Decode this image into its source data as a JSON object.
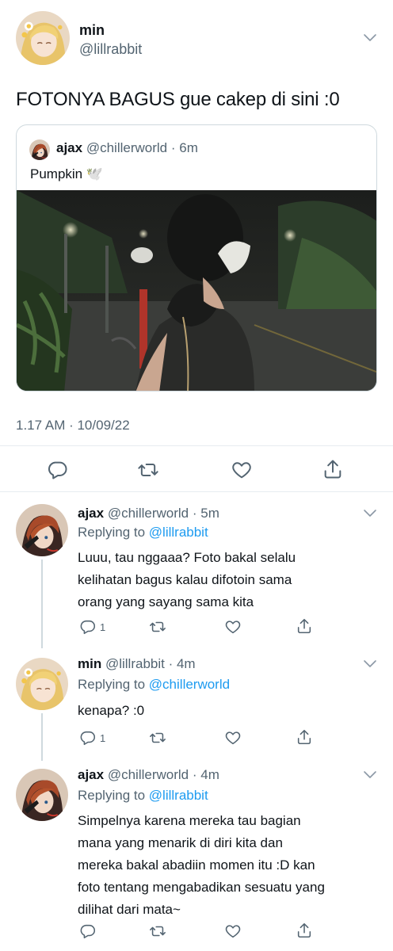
{
  "main_tweet": {
    "name": "min",
    "handle": "@lillrabbit",
    "text": "FOTONYA BAGUS gue cakep di sini :0",
    "timestamp": "1.17 AM · 10/09/22",
    "quote": {
      "name": "ajax",
      "handle": "@chillerworld",
      "time": "6m",
      "text": "Pumpkin 🕊️"
    },
    "actions": [
      "reply-icon",
      "retweet-icon",
      "like-icon",
      "share-icon"
    ]
  },
  "replies": [
    {
      "name": "ajax",
      "handle": "@chillerworld",
      "time": "5m",
      "replying_label": "Replying to",
      "replying_to": "@lillrabbit",
      "text": "Luuu, tau nggaaa? Foto bakal selalu\nkelihatan bagus kalau difotoin sama\norang yang sayang sama kita",
      "reply_count": "1"
    },
    {
      "name": "min",
      "handle": "@lillrabbit",
      "time": "4m",
      "replying_label": "Replying to",
      "replying_to": "@chillerworld",
      "text": "kenapa? :0",
      "reply_count": "1"
    },
    {
      "name": "ajax",
      "handle": "@chillerworld",
      "time": "4m",
      "replying_label": "Replying to",
      "replying_to": "@lillrabbit",
      "text": "Simpelnya karena mereka tau bagian\nmana yang menarik di diri kita dan\nmereka bakal abadiin momen itu :D kan\nfoto tentang mengabadikan sesuatu yang\ndilihat dari mata~",
      "reply_count": ""
    }
  ],
  "colors": {
    "text": "#0f1419",
    "secondary": "#536471",
    "link": "#1d9bf0",
    "border": "#cfd9de"
  }
}
